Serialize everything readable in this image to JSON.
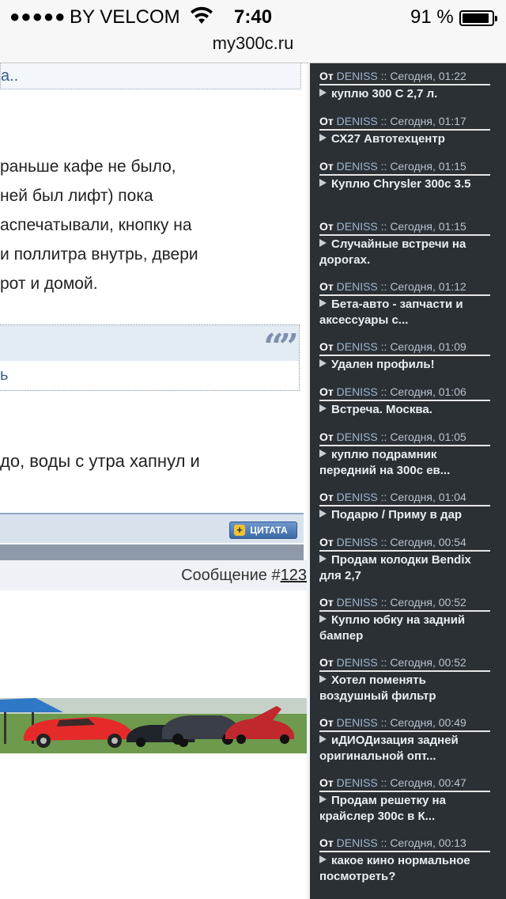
{
  "status_bar": {
    "signal_dots": "●●●●●",
    "carrier": "BY VELCOM",
    "time": "7:40",
    "battery_percent": "91 %",
    "battery_level": 0.91,
    "url": "my300c.ru"
  },
  "main": {
    "link_fragment": "а..",
    "post_lines": [
      "раньше кафе не было,",
      "ней был лифт) пока",
      "аспечатывали, кнопку на",
      "и поллитра внутрь, двери",
      "рот и домой."
    ],
    "quote_mark": "“”",
    "quote_link": "ь",
    "post_line2": "до, воды с утра хапнул и",
    "quote_button": "ЦИТАТА",
    "quote_button_icon": "plus-icon",
    "message_label": "Сообщение #",
    "message_number": "123"
  },
  "sidebar": {
    "prefix": "От",
    "items": [
      {
        "author": "DENISS",
        "time": ":: Сегодня, 01:22",
        "title": "куплю 300 С 2,7 л."
      },
      {
        "author": "DENISS",
        "time": ":: Сегодня, 01:17",
        "title": "СХ27 Автотехцентр"
      },
      {
        "author": "DENISS",
        "time": ":: Сегодня, 01:15",
        "title": "Куплю Chrysler 300c 3.5"
      },
      {
        "author": "DENISS",
        "time": ":: Сегодня, 01:15",
        "title": "Случайные встречи на дорогах."
      },
      {
        "author": "DENISS",
        "time": ":: Сегодня, 01:12",
        "title": "Бета-авто - запчасти и аксессуары с..."
      },
      {
        "author": "DENISS",
        "time": ":: Сегодня, 01:09",
        "title": "Удален профиль!"
      },
      {
        "author": "DENISS",
        "time": ":: Сегодня, 01:06",
        "title": "Встреча. Москва."
      },
      {
        "author": "DENISS",
        "time": ":: Сегодня, 01:05",
        "title": "куплю подрамник передний на 300с ев..."
      },
      {
        "author": "DENISS",
        "time": ":: Сегодня, 01:04",
        "title": "Подарю / Приму в дар"
      },
      {
        "author": "DENISS",
        "time": ":: Сегодня, 00:54",
        "title": "Продам колодки Bendix для 2,7"
      },
      {
        "author": "DENISS",
        "time": ":: Сегодня, 00:52",
        "title": "Куплю юбку на задний бампер"
      },
      {
        "author": "DENISS",
        "time": ":: Сегодня, 00:52",
        "title": "Хотел поменять воздушный фильтр"
      },
      {
        "author": "DENISS",
        "time": ":: Сегодня, 00:49",
        "title": "иДИОДизация задней оригинальной опт..."
      },
      {
        "author": "DENISS",
        "time": ":: Сегодня, 00:47",
        "title": "Продам решетку на крайслер 300с в К..."
      },
      {
        "author": "DENISS",
        "time": ":: Сегодня, 00:13",
        "title": "какое кино нормальное посмотреть?"
      }
    ]
  }
}
